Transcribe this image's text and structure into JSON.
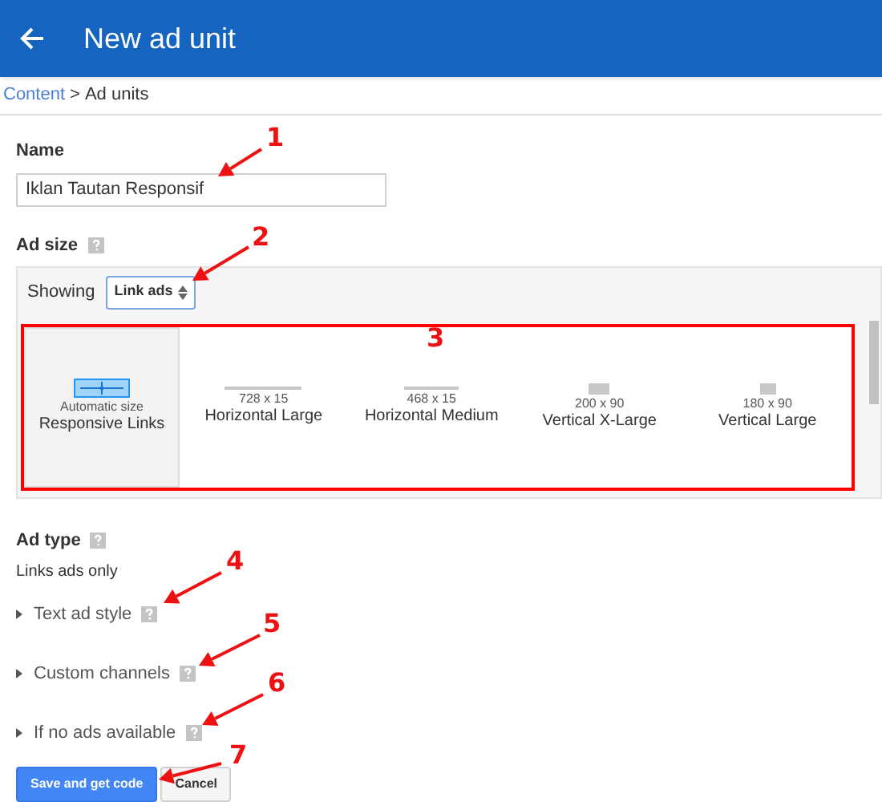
{
  "header": {
    "title": "New ad unit"
  },
  "breadcrumb": {
    "link": "Content",
    "separator": ">",
    "current": "Ad units"
  },
  "name_field": {
    "label": "Name",
    "value": "Iklan Tautan Responsif"
  },
  "ad_size": {
    "label": "Ad size",
    "showing_label": "Showing",
    "select_value": "Link ads",
    "sizes": [
      {
        "kind": "responsive",
        "dimensions": "Automatic size",
        "name": "Responsive Links",
        "selected": true
      },
      {
        "kind": "line-large",
        "dimensions": "728 x 15",
        "name": "Horizontal Large",
        "selected": false
      },
      {
        "kind": "line-medium",
        "dimensions": "468 x 15",
        "name": "Horizontal Medium",
        "selected": false
      },
      {
        "kind": "block-large",
        "dimensions": "200 x 90",
        "name": "Vertical X-Large",
        "selected": false
      },
      {
        "kind": "block-medium",
        "dimensions": "180 x 90",
        "name": "Vertical Large",
        "selected": false
      }
    ]
  },
  "ad_type": {
    "label": "Ad type",
    "note": "Links ads only"
  },
  "sections": [
    {
      "label": "Text ad style",
      "expanded": false
    },
    {
      "label": "Custom channels",
      "expanded": false
    },
    {
      "label": "If no ads available",
      "expanded": false
    }
  ],
  "buttons": [
    {
      "label": "Save and get code",
      "kind": "primary"
    },
    {
      "label": "Cancel",
      "kind": "secondary"
    }
  ],
  "annotations": [
    {
      "label": "1"
    },
    {
      "label": "2"
    },
    {
      "label": "3"
    },
    {
      "label": "4"
    },
    {
      "label": "5"
    },
    {
      "label": "6"
    },
    {
      "label": "7"
    }
  ]
}
